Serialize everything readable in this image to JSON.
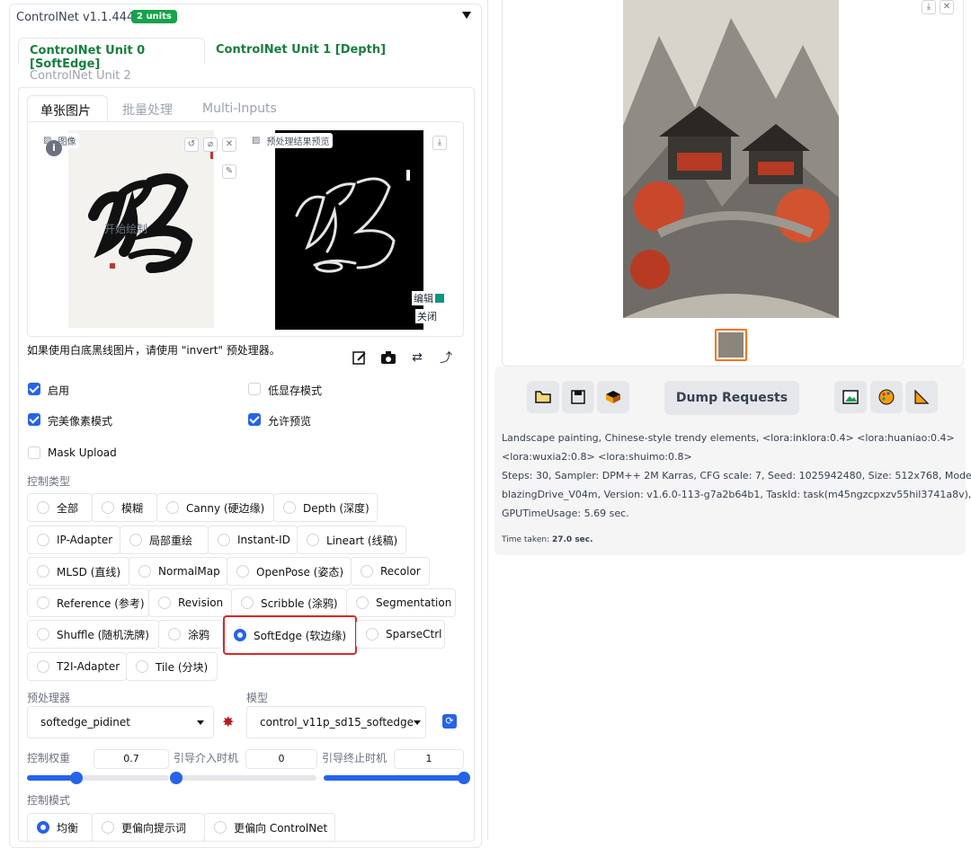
{
  "controlnet": {
    "title": "ControlNet v1.1.444",
    "units_badge": "2 units",
    "unit_tabs": [
      "ControlNet Unit 0 [SoftEdge]",
      "ControlNet Unit 1 [Depth]",
      "ControlNet Unit 2"
    ],
    "image_tabs": [
      "单张图片",
      "批量处理",
      "Multi-Inputs"
    ],
    "image_label": "图像",
    "preview_label": "预处理结果预览",
    "start_draw": "开始绘制",
    "edit_label": "编辑",
    "close_label": "关闭",
    "invert_note": "如果使用白底黑线图片，请使用 \"invert\" 预处理器。",
    "checkboxes": {
      "enable": {
        "label": "启用",
        "checked": true
      },
      "low_vram": {
        "label": "低显存模式",
        "checked": false
      },
      "pixel_perfect": {
        "label": "完美像素模式",
        "checked": true
      },
      "allow_preview": {
        "label": "允许预览",
        "checked": true
      },
      "mask_upload": {
        "label": "Mask Upload",
        "checked": false
      }
    },
    "control_type_label": "控制类型",
    "control_types": [
      [
        "全部",
        "模糊",
        "Canny (硬边缘)",
        "Depth (深度)"
      ],
      [
        "IP-Adapter",
        "局部重绘",
        "Instant-ID",
        "Lineart (线稿)"
      ],
      [
        "MLSD (直线)",
        "NormalMap",
        "OpenPose (姿态)",
        "Recolor"
      ],
      [
        "Reference (参考)",
        "Revision",
        "Scribble (涂鸦)",
        "Segmentation"
      ],
      [
        "Shuffle (随机洗牌)",
        "涂鸦",
        "SoftEdge (软边缘)",
        "SparseCtrl"
      ],
      [
        "T2I-Adapter",
        "Tile (分块)"
      ]
    ],
    "selected_control_type": "SoftEdge (软边缘)",
    "preprocessor_label": "预处理器",
    "preprocessor_value": "softedge_pidinet",
    "model_label": "模型",
    "model_value": "control_v11p_sd15_softedge",
    "weight_label": "控制权重",
    "weight_value": "0.7",
    "weight_fraction": 0.35,
    "start_label": "引导介入时机",
    "start_value": "0",
    "start_fraction": 0.0,
    "end_label": "引导终止时机",
    "end_value": "1",
    "end_fraction": 1.0,
    "mode_label": "控制模式",
    "modes": [
      "均衡",
      "更偏向提示词",
      "更偏向 ControlNet"
    ],
    "selected_mode": "均衡"
  },
  "output": {
    "dump_label": "Dump Requests",
    "info_lines": [
      "Landscape painting, Chinese-style trendy elements, <lora:inklora:0.4> <lora:huaniao:0.4>",
      "<lora:wuxia2:0.8> <lora:shuimo:0.8>",
      "Steps: 30, Sampler: DPM++ 2M Karras, CFG scale: 7, Seed: 1025942480, Size: 512x768, Model:",
      "blazingDrive_V04m, Version: v1.6.0-113-g7a2b64b1, TaskId: task(m45ngzcpxzv55hil3741a8v),",
      "GPUTimeUsage: 5.69 sec."
    ],
    "time_label": "Time taken:",
    "time_value": "27.0 sec."
  },
  "colors": {
    "accent": "#2563eb",
    "green": "#15803d",
    "highlight": "#dc2626"
  }
}
